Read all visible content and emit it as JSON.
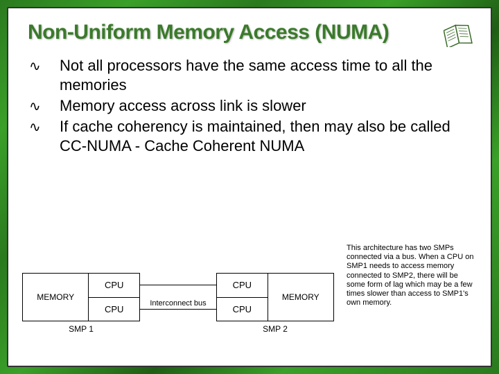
{
  "title": "Non-Uniform Memory Access (NUMA)",
  "bullets": [
    "Not all processors have the same access time to all the memories",
    "Memory access across link is slower",
    "If cache coherency is maintained, then may also be called CC-NUMA - Cache Coherent NUMA"
  ],
  "diagram": {
    "smp1": {
      "mem": "MEMORY",
      "cpu_top": "CPU",
      "cpu_bot": "CPU",
      "label": "SMP 1"
    },
    "smp2": {
      "mem": "MEMORY",
      "cpu_top": "CPU",
      "cpu_bot": "CPU",
      "label": "SMP 2"
    },
    "bus_label": "Interconnect bus"
  },
  "sidenote": "This architecture has two SMPs connected via a bus. When a CPU on SMP1 needs to access memory connected to SMP2, there will be some form of lag which may be a few times slower than access to SMP1's own memory."
}
